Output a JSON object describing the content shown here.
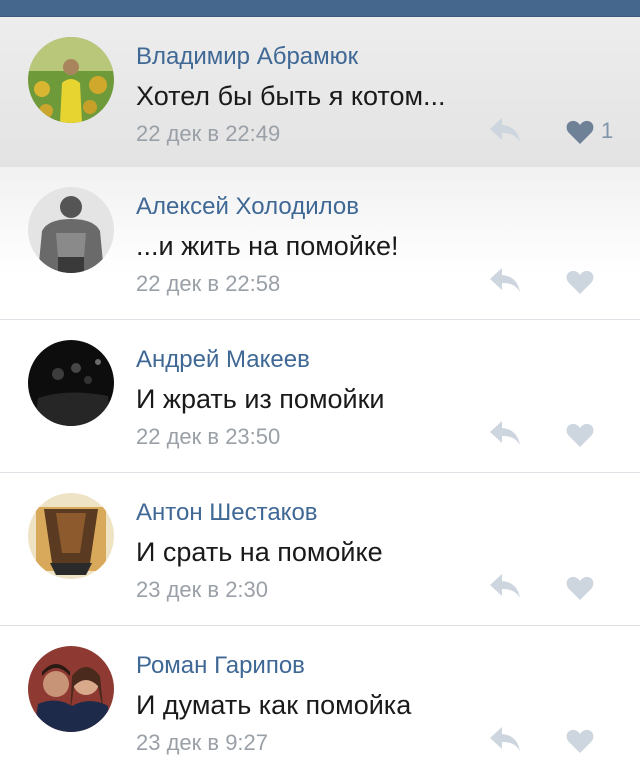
{
  "colors": {
    "header": "#45678e",
    "author_name": "#3f6895",
    "date": "#9aa0a7",
    "like_active": "#6f8197",
    "icon_inactive": "#cdd5de"
  },
  "comments": [
    {
      "author": "Владимир Абрамюк",
      "text": "Хотел бы быть я котом...",
      "date": "22 дек в 22:49",
      "likes": "1",
      "liked": true,
      "avatar_icon": "avatar-photo"
    },
    {
      "author": "Алексей Холодилов",
      "text": "...и жить на помойке!",
      "date": "22 дек в 22:58",
      "likes": "",
      "liked": false,
      "avatar_icon": "avatar-photo"
    },
    {
      "author": "Андрей Макеев",
      "text": "И жрать из помойки",
      "date": "22 дек в 23:50",
      "likes": "",
      "liked": false,
      "avatar_icon": "avatar-photo"
    },
    {
      "author": "Антон Шестаков",
      "text": "И срать на помойке",
      "date": "23 дек в 2:30",
      "likes": "",
      "liked": false,
      "avatar_icon": "avatar-photo"
    },
    {
      "author": "Роман Гарипов",
      "text": "И думать как помойка",
      "date": "23 дек в 9:27",
      "likes": "",
      "liked": false,
      "avatar_icon": "avatar-photo"
    }
  ]
}
